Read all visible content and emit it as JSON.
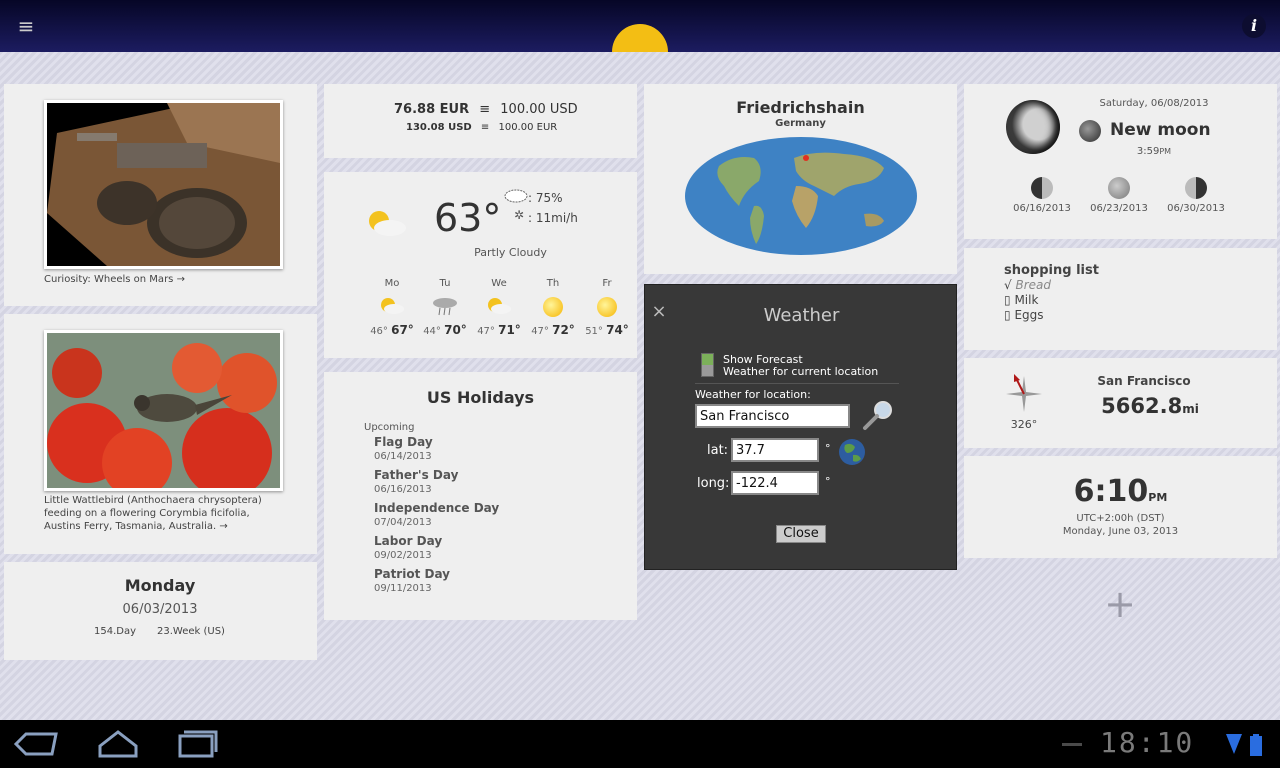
{
  "top_bar": {
    "menu_icon": "menu-icon",
    "info_label": "i"
  },
  "photo1": {
    "caption": "Curiosity: Wheels on Mars →"
  },
  "photo2": {
    "caption_lines": [
      "Little Wattlebird (Anthochaera chrysoptera)",
      "feeding on a flowering Corymbia ficifolia,",
      "Austins Ferry, Tasmania, Australia. →"
    ]
  },
  "date_card": {
    "day": "Monday",
    "date": "06/03/2013",
    "day_of_year": "154.Day",
    "week": "23.Week (US)"
  },
  "currency": {
    "row1_amount": "76.88 EUR",
    "row1_sep": "≡",
    "row1_base": "100.00 USD",
    "row2_amount": "130.08 USD",
    "row2_sep": "≡",
    "row2_base": "100.00 EUR"
  },
  "weather": {
    "temperature": "63°",
    "humidity": ": 75%",
    "wind": ": 11mi/h",
    "condition": "Partly Cloudy",
    "forecast": [
      {
        "day": "Mo",
        "low": "46°",
        "high": "67°",
        "icon": "partly-cloudy"
      },
      {
        "day": "Tu",
        "low": "44°",
        "high": "70°",
        "icon": "rain"
      },
      {
        "day": "We",
        "low": "47°",
        "high": "71°",
        "icon": "partly-cloudy"
      },
      {
        "day": "Th",
        "low": "47°",
        "high": "72°",
        "icon": "sunny"
      },
      {
        "day": "Fr",
        "low": "51°",
        "high": "74°",
        "icon": "sunny"
      }
    ]
  },
  "holidays": {
    "title": "US Holidays",
    "section": "Upcoming",
    "items": [
      {
        "name": "Flag Day",
        "date": "06/14/2013"
      },
      {
        "name": "Father's Day",
        "date": "06/16/2013"
      },
      {
        "name": "Independence Day",
        "date": "07/04/2013"
      },
      {
        "name": "Labor Day",
        "date": "09/02/2013"
      },
      {
        "name": "Patriot Day",
        "date": "09/11/2013"
      }
    ]
  },
  "location_card": {
    "city": "Friedrichshain",
    "country": "Germany"
  },
  "weather_dialog": {
    "title": "Weather",
    "close_x": "×",
    "show_forecast": "Show Forecast",
    "current_location": "Weather for current location",
    "location_label": "Weather for location:",
    "location_value": "San Francisco",
    "lat_label": "lat:",
    "lat_value": "37.7",
    "long_label": "long:",
    "long_value": "-122.4",
    "degree": "°",
    "close_button": "Close"
  },
  "moon": {
    "date": "Saturday, 06/08/2013",
    "phase": "New moon",
    "time": "3:59",
    "time_suffix": "PM",
    "upcoming": [
      "06/16/2013",
      "06/23/2013",
      "06/30/2013"
    ]
  },
  "shopping": {
    "title": "shopping list",
    "items": [
      {
        "mark": "√",
        "label": "Bread",
        "done": true
      },
      {
        "mark": "▯",
        "label": "Milk",
        "done": false
      },
      {
        "mark": "▯",
        "label": "Eggs",
        "done": false
      }
    ]
  },
  "compass": {
    "heading": "326°",
    "city": "San Francisco",
    "distance": "5662.8",
    "unit": "mi"
  },
  "clock": {
    "time": "6:10",
    "suffix": "PM",
    "tz": "UTC+2:00h (DST)",
    "date": "Monday, June 03, 2013"
  },
  "add_widget": {
    "label": "+"
  },
  "system_bar": {
    "time": "18:10"
  },
  "colors": {
    "topbar": "#0a0a35",
    "sun": "#f3be14",
    "dialog": "#383838",
    "card": "#efefef"
  }
}
